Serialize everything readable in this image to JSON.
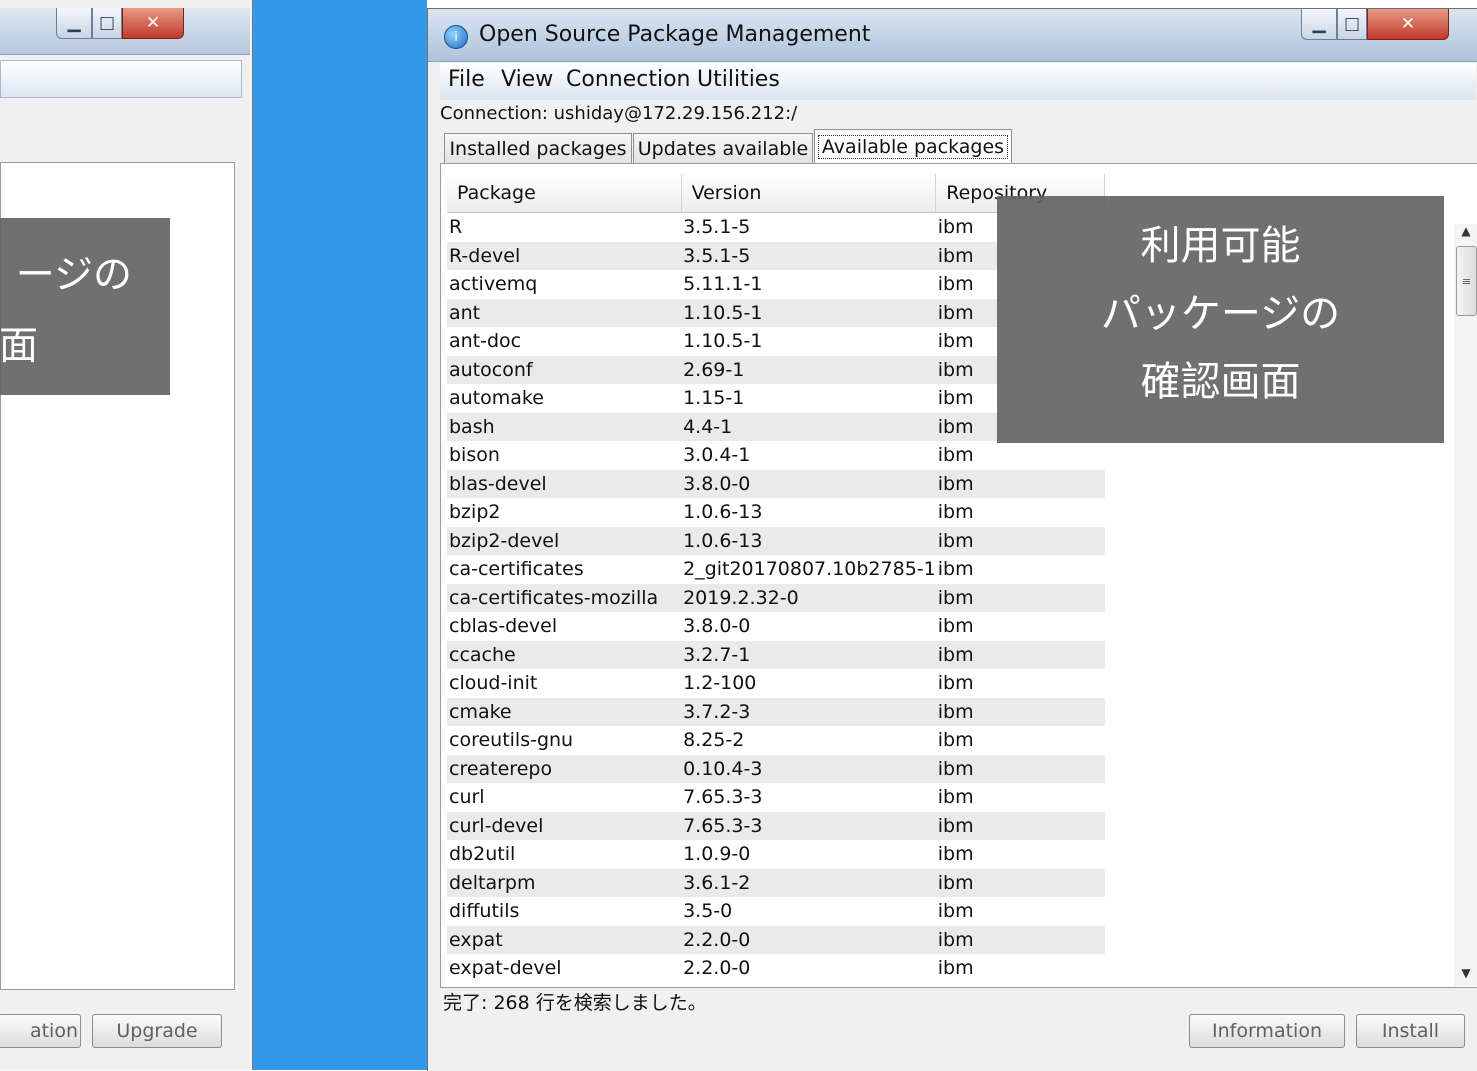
{
  "left_window": {
    "overlay_lines": [
      "ージの",
      "面"
    ],
    "buttons": {
      "information_partial": "ation",
      "upgrade": "Upgrade"
    }
  },
  "main_window": {
    "title": "Open Source Package Management",
    "menu": [
      "File",
      "View",
      "Connection",
      "Utilities"
    ],
    "connection": "Connection: ushiday@172.29.156.212:/",
    "tabs": [
      "Installed packages",
      "Updates available",
      "Available packages"
    ],
    "active_tab": "Available packages",
    "table": {
      "columns": [
        "Package",
        "Version",
        "Repository"
      ],
      "rows": [
        [
          "R",
          "3.5.1-5",
          "ibm"
        ],
        [
          "R-devel",
          "3.5.1-5",
          "ibm"
        ],
        [
          "activemq",
          "5.11.1-1",
          "ibm"
        ],
        [
          "ant",
          "1.10.5-1",
          "ibm"
        ],
        [
          "ant-doc",
          "1.10.5-1",
          "ibm"
        ],
        [
          "autoconf",
          "2.69-1",
          "ibm"
        ],
        [
          "automake",
          "1.15-1",
          "ibm"
        ],
        [
          "bash",
          "4.4-1",
          "ibm"
        ],
        [
          "bison",
          "3.0.4-1",
          "ibm"
        ],
        [
          "blas-devel",
          "3.8.0-0",
          "ibm"
        ],
        [
          "bzip2",
          "1.0.6-13",
          "ibm"
        ],
        [
          "bzip2-devel",
          "1.0.6-13",
          "ibm"
        ],
        [
          "ca-certificates",
          "2_git20170807.10b2785-1",
          "ibm"
        ],
        [
          "ca-certificates-mozilla",
          "2019.2.32-0",
          "ibm"
        ],
        [
          "cblas-devel",
          "3.8.0-0",
          "ibm"
        ],
        [
          "ccache",
          "3.2.7-1",
          "ibm"
        ],
        [
          "cloud-init",
          "1.2-100",
          "ibm"
        ],
        [
          "cmake",
          "3.7.2-3",
          "ibm"
        ],
        [
          "coreutils-gnu",
          "8.25-2",
          "ibm"
        ],
        [
          "createrepo",
          "0.10.4-3",
          "ibm"
        ],
        [
          "curl",
          "7.65.3-3",
          "ibm"
        ],
        [
          "curl-devel",
          "7.65.3-3",
          "ibm"
        ],
        [
          "db2util",
          "1.0.9-0",
          "ibm"
        ],
        [
          "deltarpm",
          "3.6.1-2",
          "ibm"
        ],
        [
          "diffutils",
          "3.5-0",
          "ibm"
        ],
        [
          "expat",
          "2.2.0-0",
          "ibm"
        ],
        [
          "expat-devel",
          "2.2.0-0",
          "ibm"
        ]
      ]
    },
    "status": "完了: 268 行を検索しました。",
    "buttons": {
      "information": "Information",
      "install": "Install"
    }
  },
  "overlay_caption": [
    "利用可能",
    "パッケージの",
    "確認画面"
  ],
  "icons": {
    "minimize": "minimize-icon",
    "maximize": "maximize-icon",
    "close": "close-icon",
    "app": "app-icon",
    "scroll_up": "scroll-up-icon",
    "scroll_down": "scroll-down-icon"
  },
  "colors": {
    "desktop": "#3399ea",
    "overlay": "#646464",
    "close_button": "#c0392b"
  }
}
